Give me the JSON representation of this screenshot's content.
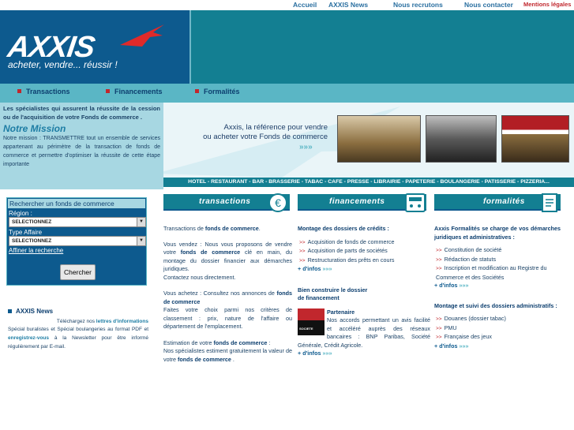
{
  "topnav": [
    "Accueil",
    "AXXIS News",
    "Nous recrutons",
    "Nous contacter",
    "Mentions légales"
  ],
  "logo": {
    "brand": "AXXIS",
    "tagline": "acheter, vendre... réussir !"
  },
  "mainnav": [
    "Transactions",
    "Financements",
    "Formalités"
  ],
  "intro": {
    "lead": "Les spécialistes qui assurent la réussite de la cession ou de l'acquisition de votre Fonds de commerce .",
    "mission_title": "Notre Mission",
    "mission_text": "Notre mission : TRANSMETTRE tout un ensemble de services appartenant au périmètre de la transaction de fonds de commerce et permettre d'optimiser la réussite de cette étape importante"
  },
  "banner": {
    "line1": "Axxis, la référence pour vendre",
    "line2": "ou acheter votre Fonds de commerce",
    "arrows": "»»»"
  },
  "strip": "HOTEL - RESTAURANT - BAR - BRASSERIE - TABAC - CAFE - PRESSE - LIBRAIRIE - PAPETERIE - BOULANGERIE - PATISSERIE - PIZZERIA...",
  "search": {
    "title": "Rechercher un fonds de commerce",
    "region_label": "Région :",
    "region_value": "SELECTIONNEZ",
    "type_label": "Type Affaire",
    "type_value": "SELECTIONNEZ",
    "refine": "Affiner la recherche",
    "button": "Chercher"
  },
  "news": {
    "title": "AXXIS News",
    "t1": "Téléchargez nos",
    "t2": "lettres d'informations",
    "t3": "Spécial buralistes et Spécial boulangeries au format PDF et",
    "t4": "enregistrez-vous",
    "t5": "à la Newsletter pour être informé régulièrement par E-mail."
  },
  "columns": {
    "transactions": {
      "header": "transactions",
      "p1a": "Transactions de",
      "p1b": "fonds de commerce",
      "p2a": "Vous vendez : Nous vous proposons de vendre votre",
      "p2b": "fonds de commerce",
      "p2c": "clé en main, du montage du dossier financier aux démarches juridiques.",
      "p2d": "Contactez nous directement.",
      "p3a": "Vous achetez : Consultez nos annonces de",
      "p3b": "fonds de commerce",
      "p3c": "Faites votre choix parmi nos critères de classement : prix, nature de l'affaire ou département de l'emplacement.",
      "p4a": "Estimation de votre",
      "p4b": "fonds de commerce",
      "p4c": "Nos spécialistes estiment gratuitement la valeur de votre",
      "p4d": "fonds de commerce"
    },
    "financements": {
      "header": "financements",
      "h1": "Montage des dossiers de crédits :",
      "items": [
        "Acquisition de fonds de commerce",
        "Acquisition de parts de sociétés",
        "Restructuration des prêts en cours"
      ],
      "more": "+ d'infos",
      "h2a": "Bien construire le dossier",
      "h2b": "de financement",
      "partner_title": "Partenaire",
      "partner_text": "Nos accords permettant un avis facilité et accéléré auprès des réseaux bancaires : BNP Paribas, Société Générale, Crédit Agricole.",
      "logo_text": "SOCIETE GENERALE"
    },
    "formalites": {
      "header": "formalités",
      "h1": "Axxis Formalités se charge de vos démarches juridiques et administratives :",
      "items1": [
        "Constitution de société",
        "Rédaction de statuts",
        "Inscription et modification au Registre du Commerce et des Sociétés"
      ],
      "h2": "Montage et suivi des dossiers administratifs :",
      "items2": [
        "Douanes (dossier tabac)",
        "PMU",
        "Française des jeux"
      ],
      "more": "+ d'infos"
    }
  },
  "colors": {
    "teal": "#137f92",
    "navy": "#0d5a8e",
    "light": "#a7d7e2",
    "red": "#c1272d"
  }
}
